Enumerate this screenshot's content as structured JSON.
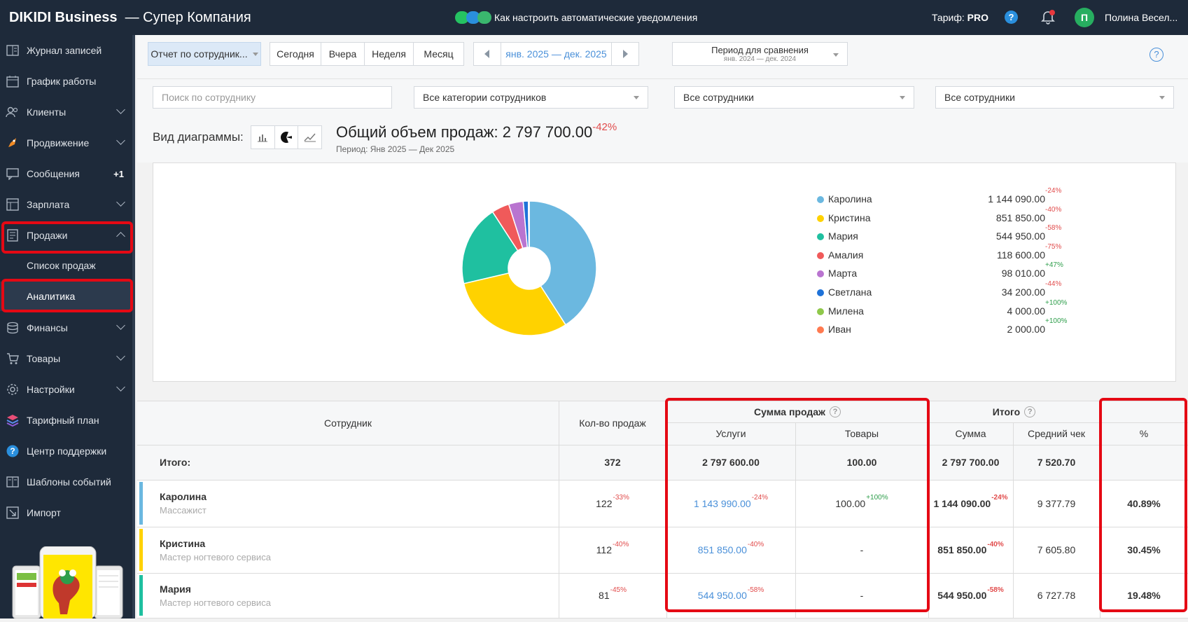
{
  "topbar": {
    "brand": "DIKIDI Business",
    "company": "— Супер Компания",
    "notice": "Как настроить автоматические уведомления",
    "tariff_label": "Тариф:",
    "tariff_value": "PRO",
    "help": "?",
    "avatar_letter": "П",
    "user_name": "Полина Весел..."
  },
  "sidebar": {
    "items": [
      {
        "label": "Журнал записей",
        "icon": "journal-icon"
      },
      {
        "label": "График работы",
        "icon": "calendar-icon"
      },
      {
        "label": "Клиенты",
        "icon": "users-icon"
      },
      {
        "label": "Продвижение",
        "icon": "rocket-icon"
      },
      {
        "label": "Сообщения",
        "icon": "message-icon",
        "badge": "+1"
      },
      {
        "label": "Зарплата",
        "icon": "salary-icon"
      },
      {
        "label": "Продажи",
        "icon": "receipt-icon"
      },
      {
        "label": "Финансы",
        "icon": "coins-icon"
      },
      {
        "label": "Товары",
        "icon": "cart-icon"
      },
      {
        "label": "Настройки",
        "icon": "gear-icon"
      },
      {
        "label": "Тарифный план",
        "icon": "layers-icon"
      },
      {
        "label": "Центр поддержки",
        "icon": "help-icon"
      },
      {
        "label": "Шаблоны событий",
        "icon": "template-icon"
      },
      {
        "label": "Импорт",
        "icon": "import-icon"
      }
    ],
    "sub_items": [
      "Список продаж",
      "Аналитика"
    ]
  },
  "toolbar": {
    "report": "Отчет по сотрудник...",
    "today": "Сегодня",
    "yesterday": "Вчера",
    "week": "Неделя",
    "month": "Месяц",
    "range": "янв. 2025 — дек. 2025",
    "compare_title": "Период для сравнения",
    "compare_range": "янв. 2024 — дек. 2024"
  },
  "filters": {
    "search_placeholder": "Поиск по сотруднику",
    "categories": "Все категории сотрудников",
    "employees1": "Все сотрудники",
    "employees2": "Все сотрудники"
  },
  "chart_header": {
    "view_label": "Вид диаграммы:",
    "total_label": "Общий объем продаж: 2 797 700.00",
    "total_change": "-42%",
    "period": "Период: Янв 2025 — Дек 2025"
  },
  "chart_data": {
    "type": "pie",
    "donut": true,
    "labels": [
      "Каролина",
      "Кристина",
      "Мария",
      "Амалия",
      "Марта",
      "Светлана",
      "Милена",
      "Иван"
    ],
    "values": [
      1144090.0,
      851850.0,
      544950.0,
      118600.0,
      98010.0,
      34200.0,
      4000.0,
      2000.0
    ],
    "value_labels": [
      "1 144 090.00",
      "851 850.00",
      "544 950.00",
      "118 600.00",
      "98 010.00",
      "34 200.00",
      "4 000.00",
      "2 000.00"
    ],
    "changes": [
      "-24%",
      "-40%",
      "-58%",
      "-75%",
      "+47%",
      "-44%",
      "+100%",
      "+100%"
    ],
    "colors": [
      "#6bb8e0",
      "#ffd200",
      "#1fc0a0",
      "#f05a5a",
      "#b974d0",
      "#1e72d8",
      "#8fc84a",
      "#ff7a50"
    ],
    "legend_position": "right"
  },
  "table": {
    "headers": {
      "employee": "Сотрудник",
      "count": "Кол-во продаж",
      "sales_sum": "Сумма продаж",
      "services": "Услуги",
      "goods": "Товары",
      "total": "Итого",
      "sum": "Сумма",
      "avg": "Средний чек",
      "pct": "%"
    },
    "totals": {
      "label": "Итого:",
      "count": "372",
      "services": "2 797 600.00",
      "goods": "100.00",
      "sum": "2 797 700.00",
      "avg": "7 520.70"
    },
    "rows": [
      {
        "name": "Каролина",
        "role": "Массажист",
        "count": "122",
        "count_change": "-33%",
        "services": "1 143 990.00",
        "services_change": "-24%",
        "goods": "100.00",
        "goods_change": "+100%",
        "sum": "1 144 090.00",
        "sum_change": "-24%",
        "avg": "9 377.79",
        "pct": "40.89%",
        "color": "#6bb8e0"
      },
      {
        "name": "Кристина",
        "role": "Мастер ногтевого сервиса",
        "count": "112",
        "count_change": "-40%",
        "services": "851 850.00",
        "services_change": "-40%",
        "goods": "-",
        "goods_change": "",
        "sum": "851 850.00",
        "sum_change": "-40%",
        "avg": "7 605.80",
        "pct": "30.45%",
        "color": "#ffd200"
      },
      {
        "name": "Мария",
        "role": "Мастер ногтевого сервиса",
        "count": "81",
        "count_change": "-45%",
        "services": "544 950.00",
        "services_change": "-58%",
        "goods": "-",
        "goods_change": "",
        "sum": "544 950.00",
        "sum_change": "-58%",
        "avg": "6 727.78",
        "pct": "19.48%",
        "color": "#1fc0a0"
      }
    ]
  }
}
